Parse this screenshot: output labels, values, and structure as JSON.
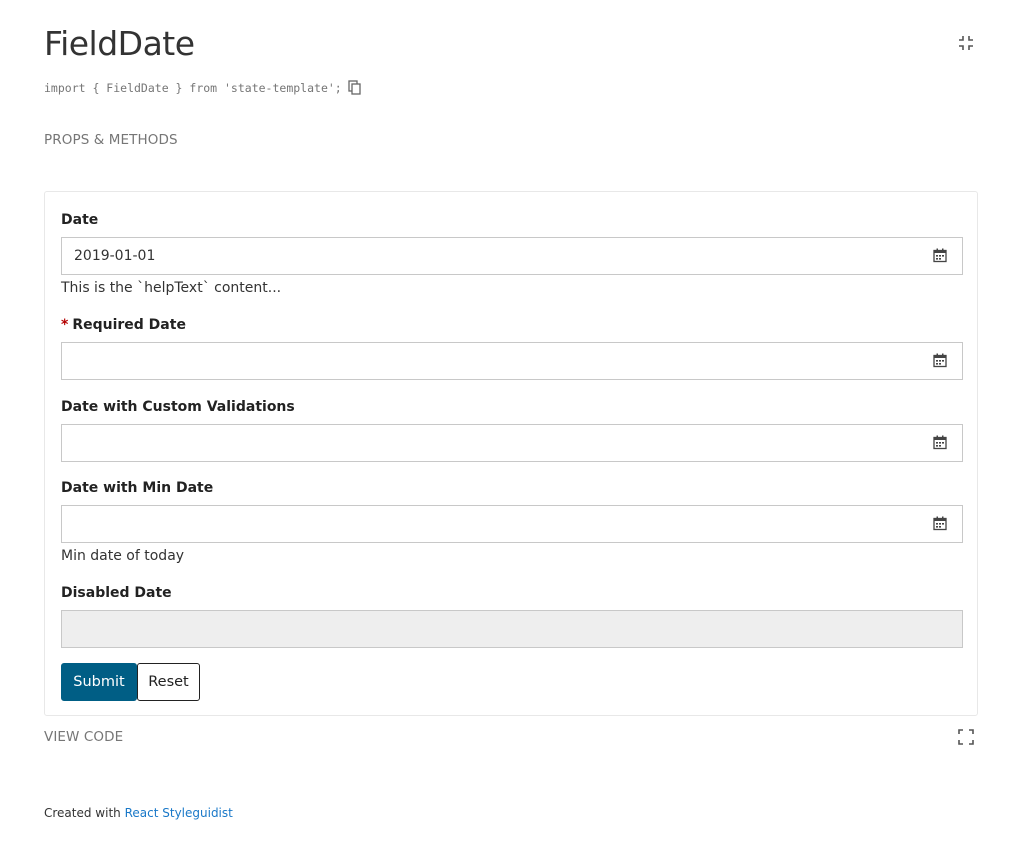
{
  "header": {
    "title": "FieldDate",
    "import_statement": "import { FieldDate } from 'state-template';",
    "collapse_icon": "collapse-icon",
    "copy_icon": "copy-icon"
  },
  "sections": {
    "props_methods": "PROPS & METHODS",
    "view_code": "VIEW CODE",
    "expand_icon": "expand-icon"
  },
  "form": {
    "fields": [
      {
        "label": "Date",
        "value": "2019-01-01",
        "required": false,
        "disabled": false,
        "help_text": "This is the `helpText` content..."
      },
      {
        "label": "Required Date",
        "value": "",
        "required": true,
        "required_marker": "*",
        "disabled": false
      },
      {
        "label": "Date with Custom Validations",
        "value": "",
        "required": false,
        "disabled": false
      },
      {
        "label": "Date with Min Date",
        "value": "",
        "required": false,
        "disabled": false,
        "help_text": "Min date of today"
      },
      {
        "label": "Disabled Date",
        "value": "",
        "required": false,
        "disabled": true
      }
    ],
    "submit_label": "Submit",
    "reset_label": "Reset"
  },
  "footer": {
    "prefix": "Created with",
    "link_text": "React Styleguidist"
  },
  "colors": {
    "primary_button": "#005e85",
    "link": "#1978c8",
    "required_star": "#b40000",
    "disabled_bg": "#eeeeee"
  }
}
